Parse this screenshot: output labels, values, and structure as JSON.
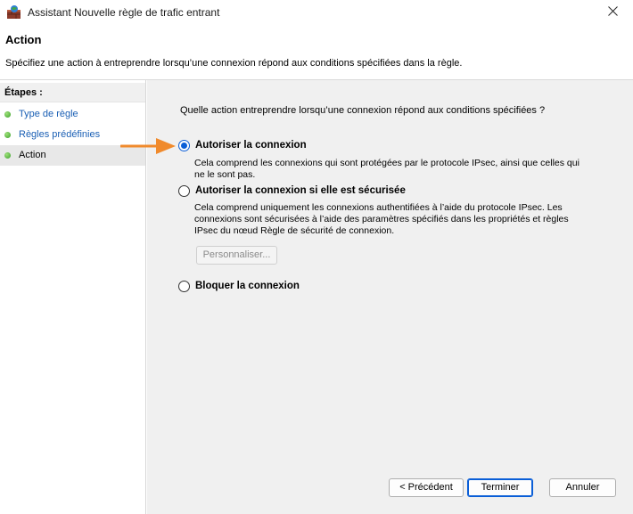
{
  "window": {
    "title": "Assistant Nouvelle règle de trafic entrant"
  },
  "header": {
    "title": "Action",
    "description": "Spécifiez une action à entreprendre lorsqu’une connexion répond aux conditions spécifiées dans la règle."
  },
  "sidebar": {
    "heading": "Étapes :",
    "steps": [
      {
        "label": "Type de règle"
      },
      {
        "label": "Règles prédéfinies"
      },
      {
        "label": "Action"
      }
    ]
  },
  "main": {
    "question": "Quelle action entreprendre lorsqu’une connexion répond aux conditions spécifiées ?",
    "options": [
      {
        "label": "Autoriser la connexion",
        "description": "Cela comprend les connexions qui sont protégées par le protocole IPsec, ainsi que celles qui ne le sont pas.",
        "selected": true
      },
      {
        "label": "Autoriser la connexion si elle est sécurisée",
        "description": "Cela comprend uniquement les connexions authentifiées à l’aide du protocole IPsec. Les connexions sont sécurisées à l’aide des paramètres spécifiés dans les propriétés et règles IPsec du nœud Règle de sécurité de connexion.",
        "selected": false
      },
      {
        "label": "Bloquer la connexion",
        "selected": false
      }
    ],
    "customize_label": "Personnaliser..."
  },
  "footer": {
    "back_label": "< Précédent",
    "finish_label": "Terminer",
    "cancel_label": "Annuler"
  },
  "colors": {
    "accent": "#0a5ed7",
    "link": "#1a5fb4",
    "arrow": "#f08a2c",
    "content_bg": "#f0f0f0"
  },
  "icons": {
    "app": "firewall-icon",
    "close": "close-icon",
    "step": "green-dot-icon",
    "pointer": "arrow-icon"
  }
}
